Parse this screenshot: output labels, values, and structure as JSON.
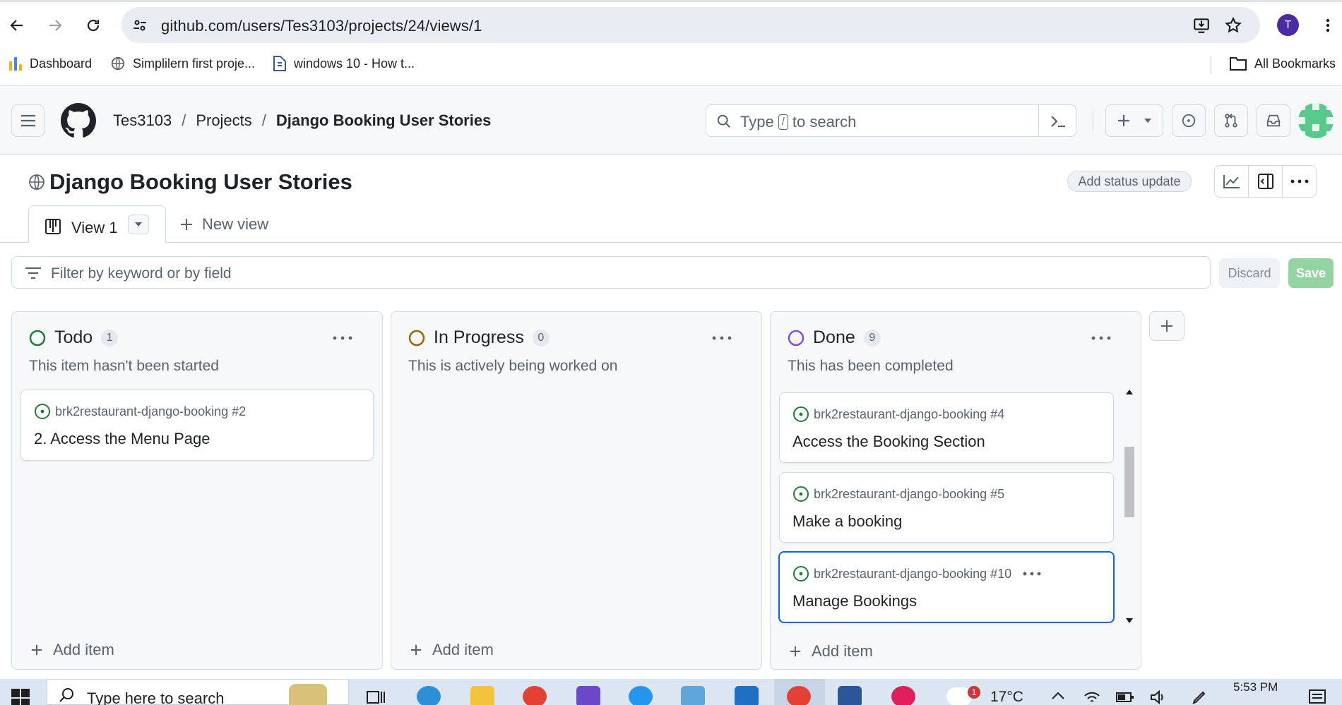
{
  "browser": {
    "url": "github.com/users/Tes3103/projects/24/views/1",
    "profile_initial": "T",
    "bookmarks": [
      {
        "label": "Dashboard",
        "icon": "dashboard-icon"
      },
      {
        "label": "Simplilern first proje...",
        "icon": "globe-icon"
      },
      {
        "label": "windows 10 - How t...",
        "icon": "page-icon"
      }
    ],
    "all_bookmarks": "All Bookmarks"
  },
  "github": {
    "breadcrumb": [
      "Tes3103",
      "Projects",
      "Django Booking User Stories"
    ],
    "search_prefix": "Type",
    "search_key": "/",
    "search_suffix": "to search"
  },
  "project": {
    "title": "Django Booking User Stories",
    "add_status_update": "Add status update",
    "tabs": [
      {
        "label": "View 1"
      }
    ],
    "new_view": "New view",
    "filter_placeholder": "Filter by keyword or by field",
    "discard": "Discard",
    "save": "Save"
  },
  "columns": [
    {
      "title": "Todo",
      "count": "1",
      "color": "#1a7f37",
      "description": "This item hasn't been started",
      "add_item": "Add item",
      "cards": [
        {
          "meta": "brk2restaurant-django-booking #2",
          "title": "2. Access the Menu Page"
        }
      ]
    },
    {
      "title": "In Progress",
      "count": "0",
      "color": "#9a6700",
      "description": "This is actively being worked on",
      "add_item": "Add item",
      "cards": []
    },
    {
      "title": "Done",
      "count": "9",
      "color": "#8250df",
      "description": "This has been completed",
      "add_item": "Add item",
      "cards": [
        {
          "meta": "brk2restaurant-django-booking #4",
          "title": "Access the Booking Section"
        },
        {
          "meta": "brk2restaurant-django-booking #5",
          "title": "Make a booking"
        },
        {
          "meta": "brk2restaurant-django-booking #10",
          "title": "Manage Bookings"
        }
      ]
    }
  ],
  "colors": {
    "issue_open": "#1a7f37",
    "focus": "#0969da",
    "save_disabled": "#94d3a2"
  },
  "taskbar": {
    "search_placeholder": "Type here to search",
    "temperature": "17°C",
    "time": "5:53 PM",
    "weather_badge": "1"
  }
}
